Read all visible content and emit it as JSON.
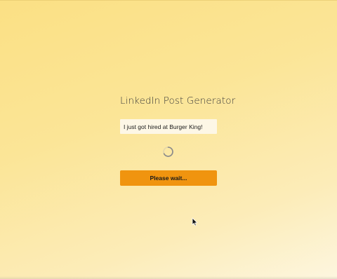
{
  "app": {
    "title": "LinkedIn Post Generator"
  },
  "form": {
    "input_value": "I just got hired at Burger King!",
    "loading": true,
    "spinner_icon": "loading-spinner-icon",
    "submit_label": "Please wait..."
  },
  "colors": {
    "background_start": "#fbe084",
    "background_end": "#fdf6df",
    "input_background": "#fdf7e6",
    "button_accent": "#f0940f",
    "spinner_gray": "#8a8a8a"
  },
  "cursor_icon": "mouse-pointer-icon"
}
